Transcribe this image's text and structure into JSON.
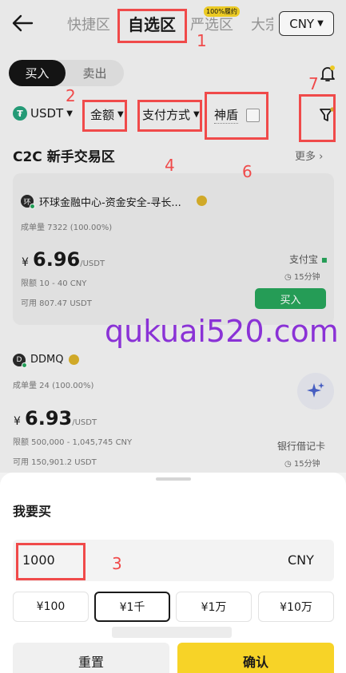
{
  "nav": {
    "tabs": [
      "快捷区",
      "自选区",
      "严选区",
      "大宗"
    ],
    "active_tab": "自选区",
    "tab_badge": "100%履约",
    "currency": "CNY"
  },
  "trade": {
    "buy_label": "买入",
    "sell_label": "卖出"
  },
  "filters": {
    "coin": "USDT",
    "amount": "金额",
    "payment": "支付方式",
    "shield": "神盾"
  },
  "annotations": [
    "1",
    "2",
    "3",
    "4",
    "6",
    "7"
  ],
  "section": {
    "title": "C2C 新手交易区",
    "more": "更多"
  },
  "ads": [
    {
      "avatar": "环",
      "name": "环球金融中心-资金安全-寻长...",
      "volume": "成单量 7322 (100.00%)",
      "currency_symbol": "¥",
      "price": "6.96",
      "unit": "/USDT",
      "limit": "限额  10 - 40 CNY",
      "available": "可用  807.47 USDT",
      "payment": "支付宝",
      "time": "15分钟",
      "buy": "买入"
    },
    {
      "avatar": "D",
      "name": "DDMQ",
      "volume": "成单量 24 (100.00%)",
      "currency_symbol": "¥",
      "price": "6.93",
      "unit": "/USDT",
      "limit": "限额  500,000 - 1,045,745 CNY",
      "available": "可用  150,901.2 USDT",
      "payment": "银行借记卡",
      "time": "15分钟"
    }
  ],
  "watermark": "qukuai520.com",
  "sheet": {
    "title": "我要买",
    "amount_value": "1000",
    "amount_currency": "CNY",
    "quick_amounts": [
      "¥100",
      "¥1千",
      "¥1万",
      "¥10万"
    ],
    "selected_quick": "¥1千",
    "reset": "重置",
    "confirm": "确认"
  },
  "colors": {
    "accent": "#f7d327",
    "buy_green": "#27a35a",
    "annotation_red": "#f04a4a"
  }
}
